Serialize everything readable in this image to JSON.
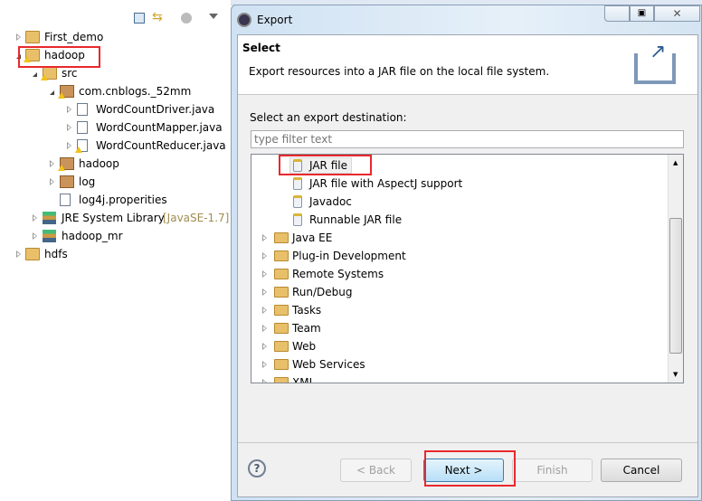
{
  "explorer": {
    "toolbar_icons": [
      "collapse-all-icon",
      "link-with-editor-icon",
      "view-menu-icon"
    ],
    "tree": [
      {
        "label": "First_demo",
        "depth": 0,
        "state": "collapsed",
        "icon": "project-folder-icon"
      },
      {
        "label": "hadoop",
        "depth": 0,
        "state": "expanded",
        "icon": "project-folder-warning-icon",
        "highlighted": true
      },
      {
        "label": "src",
        "depth": 1,
        "state": "expanded",
        "icon": "source-folder-icon"
      },
      {
        "label": "com.cnblogs._52mm",
        "depth": 2,
        "state": "expanded",
        "icon": "package-icon"
      },
      {
        "label": "WordCountDriver.java",
        "depth": 3,
        "state": "collapsed",
        "icon": "java-file-icon"
      },
      {
        "label": "WordCountMapper.java",
        "depth": 3,
        "state": "collapsed",
        "icon": "java-file-icon"
      },
      {
        "label": "WordCountReducer.java",
        "depth": 3,
        "state": "collapsed",
        "icon": "java-file-warning-icon"
      },
      {
        "label": "hadoop",
        "depth": 2,
        "state": "collapsed",
        "icon": "package-icon"
      },
      {
        "label": "log",
        "depth": 2,
        "state": "collapsed",
        "icon": "package-icon"
      },
      {
        "label": "log4j.properities",
        "depth": 2,
        "state": "leaf",
        "icon": "properties-file-icon"
      },
      {
        "label": "JRE System Library",
        "suffix": "[JavaSE-1.7]",
        "depth": 1,
        "state": "collapsed",
        "icon": "library-icon"
      },
      {
        "label": "hadoop_mr",
        "depth": 1,
        "state": "collapsed",
        "icon": "library-icon"
      },
      {
        "label": "hdfs",
        "depth": 0,
        "state": "collapsed",
        "icon": "project-folder-icon"
      }
    ]
  },
  "dialog": {
    "title": "Export",
    "header_title": "Select",
    "header_desc": "Export resources into a JAR file on the local file system.",
    "dest_label": "Select an export destination:",
    "filter_placeholder": "type filter text",
    "items": [
      {
        "label": "JAR file",
        "type": "leaf",
        "selected": true
      },
      {
        "label": "JAR file with AspectJ support",
        "type": "leaf"
      },
      {
        "label": "Javadoc",
        "type": "leaf"
      },
      {
        "label": "Runnable JAR file",
        "type": "leaf"
      },
      {
        "label": "Java EE",
        "type": "folder"
      },
      {
        "label": "Plug-in Development",
        "type": "folder"
      },
      {
        "label": "Remote Systems",
        "type": "folder"
      },
      {
        "label": "Run/Debug",
        "type": "folder"
      },
      {
        "label": "Tasks",
        "type": "folder"
      },
      {
        "label": "Team",
        "type": "folder"
      },
      {
        "label": "Web",
        "type": "folder"
      },
      {
        "label": "Web Services",
        "type": "folder"
      },
      {
        "label": "XML",
        "type": "folder"
      }
    ],
    "buttons": {
      "help": "?",
      "back": "< Back",
      "next": "Next >",
      "finish": "Finish",
      "cancel": "Cancel"
    },
    "colors": {
      "highlight_box": "#e8282d",
      "default_button": "#b7dff7"
    }
  }
}
